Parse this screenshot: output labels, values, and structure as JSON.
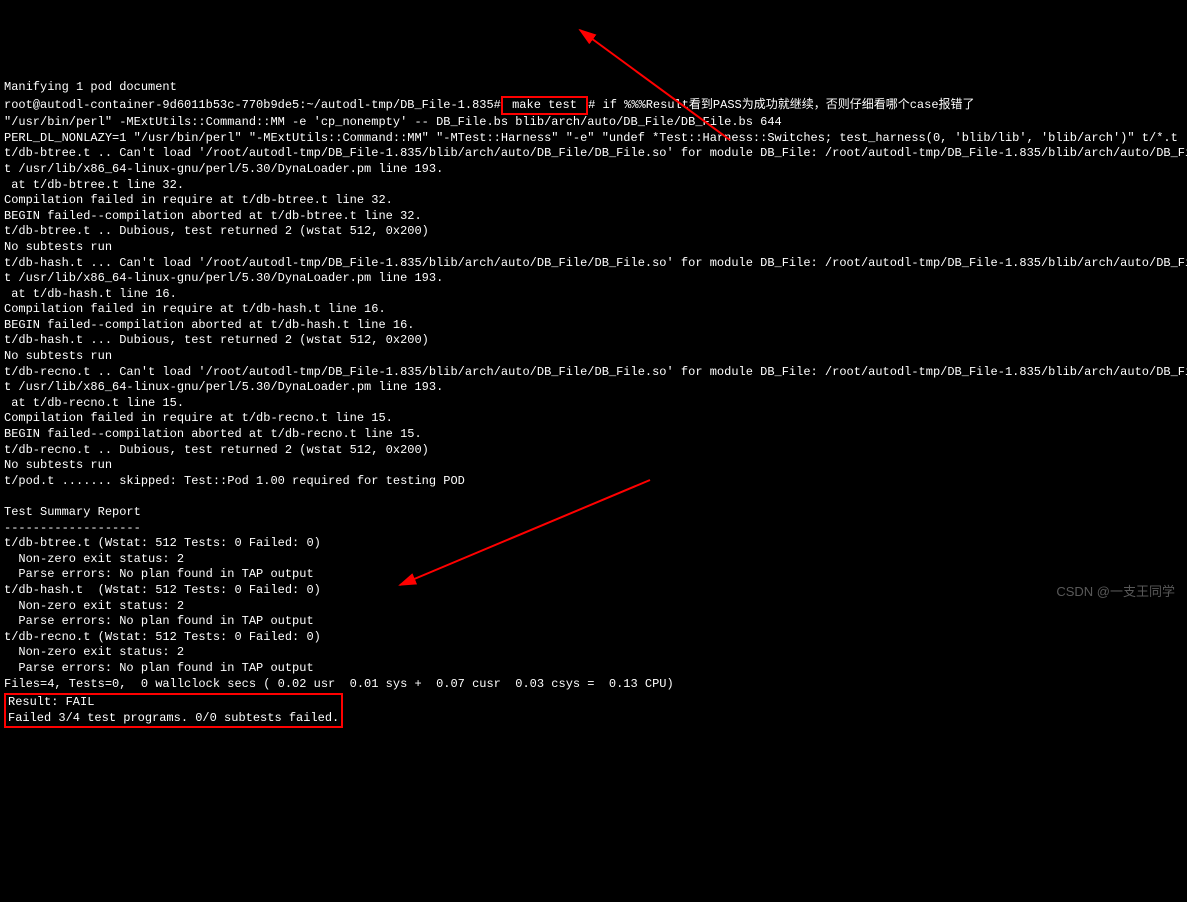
{
  "terminal": {
    "line0": "Manifying 1 pod document",
    "prompt": "root@autodl-container-9d6011b53c-770b9de5:~/autodl-tmp/DB_File-1.835#",
    "command": " make test ",
    "prompt_suffix": "# if %%%Result看到PASS为成功就继续，否则仔细看哪个case报错了",
    "cmd_out": [
      "\"/usr/bin/perl\" -MExtUtils::Command::MM -e 'cp_nonempty' -- DB_File.bs blib/arch/auto/DB_File/DB_File.bs 644",
      "PERL_DL_NONLAZY=1 \"/usr/bin/perl\" \"-MExtUtils::Command::MM\" \"-MTest::Harness\" \"-e\" \"undef *Test::Harness::Switches; test_harness(0, 'blib/lib', 'blib/arch')\" t/*.t",
      "t/db-btree.t .. Can't load '/root/autodl-tmp/DB_File-1.835/blib/arch/auto/DB_File/DB_File.so' for module DB_File: /root/autodl-tmp/DB_File-1.835/blib/arch/auto/DB_File/D",
      "t /usr/lib/x86_64-linux-gnu/perl/5.30/DynaLoader.pm line 193.",
      " at t/db-btree.t line 32.",
      "Compilation failed in require at t/db-btree.t line 32.",
      "BEGIN failed--compilation aborted at t/db-btree.t line 32.",
      "t/db-btree.t .. Dubious, test returned 2 (wstat 512, 0x200)",
      "No subtests run",
      "t/db-hash.t ... Can't load '/root/autodl-tmp/DB_File-1.835/blib/arch/auto/DB_File/DB_File.so' for module DB_File: /root/autodl-tmp/DB_File-1.835/blib/arch/auto/DB_File/D",
      "t /usr/lib/x86_64-linux-gnu/perl/5.30/DynaLoader.pm line 193.",
      " at t/db-hash.t line 16.",
      "Compilation failed in require at t/db-hash.t line 16.",
      "BEGIN failed--compilation aborted at t/db-hash.t line 16.",
      "t/db-hash.t ... Dubious, test returned 2 (wstat 512, 0x200)",
      "No subtests run",
      "t/db-recno.t .. Can't load '/root/autodl-tmp/DB_File-1.835/blib/arch/auto/DB_File/DB_File.so' for module DB_File: /root/autodl-tmp/DB_File-1.835/blib/arch/auto/DB_File/D",
      "t /usr/lib/x86_64-linux-gnu/perl/5.30/DynaLoader.pm line 193.",
      " at t/db-recno.t line 15.",
      "Compilation failed in require at t/db-recno.t line 15.",
      "BEGIN failed--compilation aborted at t/db-recno.t line 15.",
      "t/db-recno.t .. Dubious, test returned 2 (wstat 512, 0x200)",
      "No subtests run",
      "t/pod.t ....... skipped: Test::Pod 1.00 required for testing POD",
      "",
      "Test Summary Report",
      "-------------------",
      "t/db-btree.t (Wstat: 512 Tests: 0 Failed: 0)",
      "  Non-zero exit status: 2",
      "  Parse errors: No plan found in TAP output",
      "t/db-hash.t  (Wstat: 512 Tests: 0 Failed: 0)",
      "  Non-zero exit status: 2",
      "  Parse errors: No plan found in TAP output",
      "t/db-recno.t (Wstat: 512 Tests: 0 Failed: 0)",
      "  Non-zero exit status: 2",
      "  Parse errors: No plan found in TAP output",
      "Files=4, Tests=0,  0 wallclock secs ( 0.02 usr  0.01 sys +  0.07 cusr  0.03 csys =  0.13 CPU)"
    ],
    "result_line1": "Result: FAIL",
    "result_line2": "Failed 3/4 test programs. 0/0 subtests failed."
  },
  "watermark": "CSDN @一支王同学"
}
